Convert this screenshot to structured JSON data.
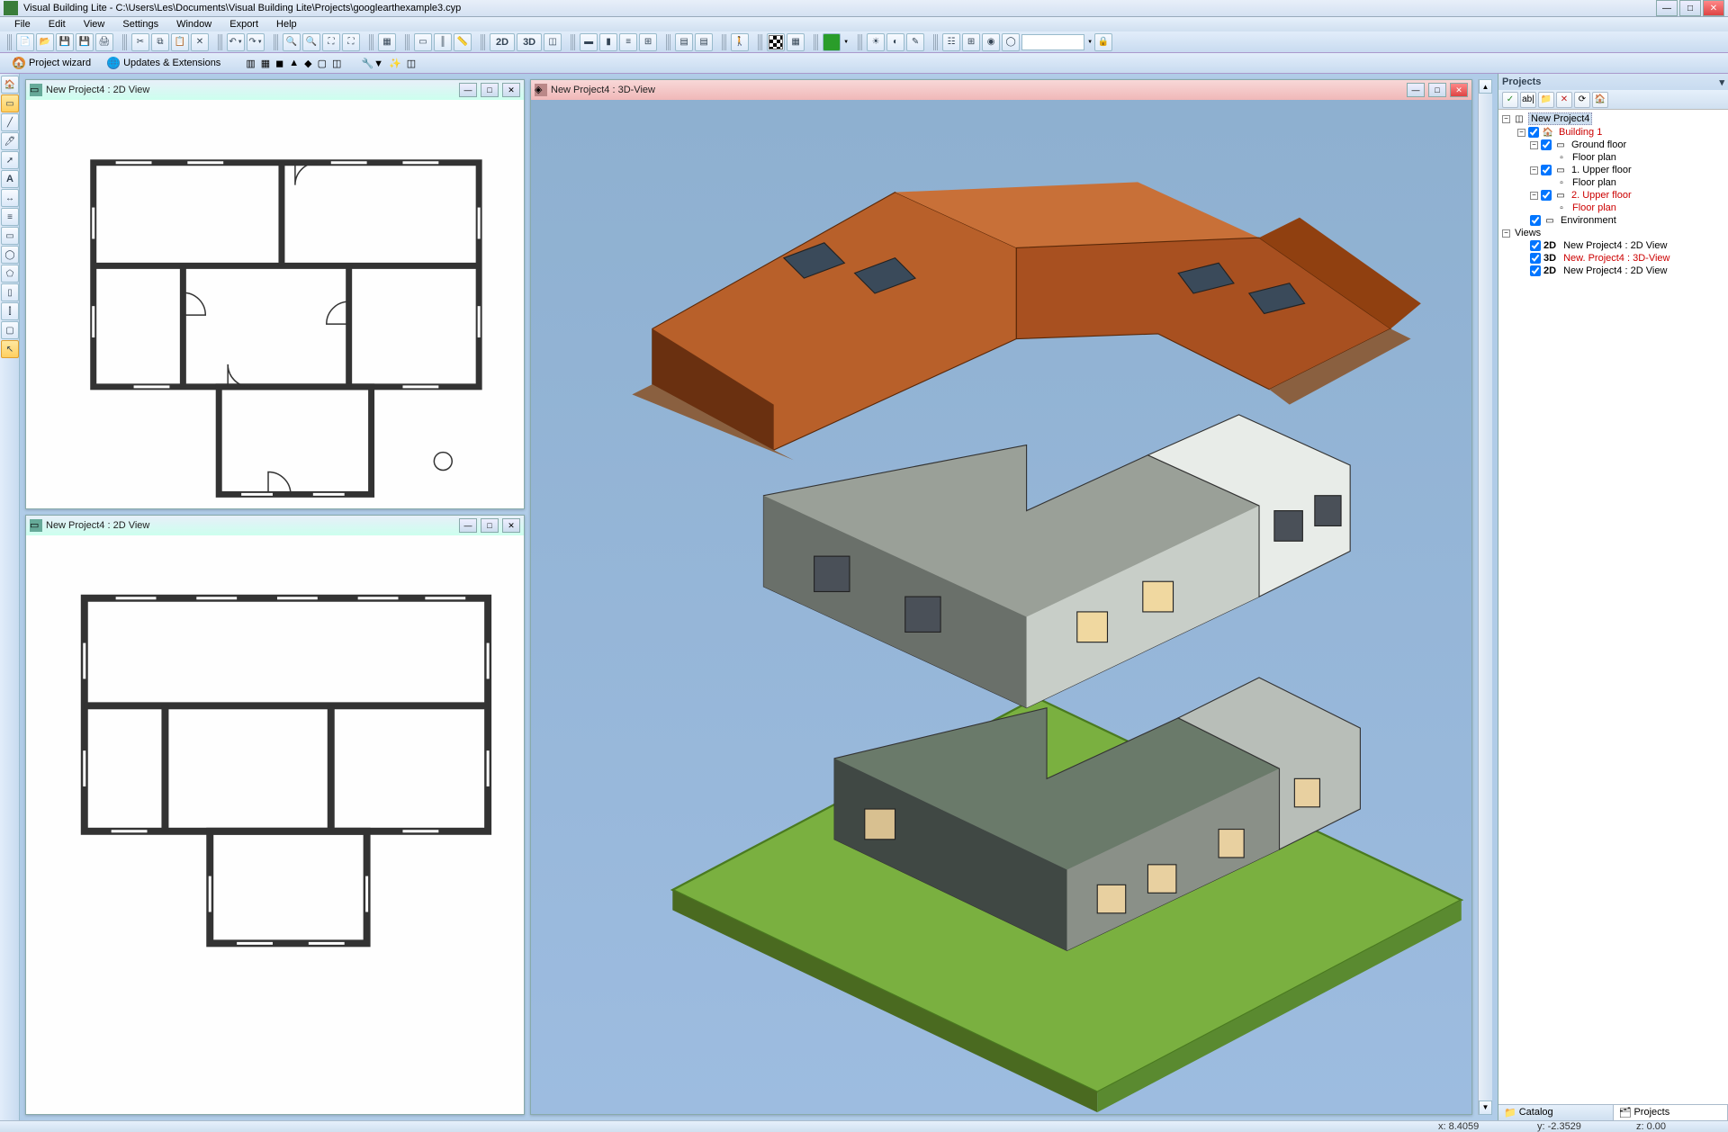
{
  "app": {
    "title": "Visual Building Lite - C:\\Users\\Les\\Documents\\Visual Building Lite\\Projects\\googlearthexample3.cyp"
  },
  "menu": [
    "File",
    "Edit",
    "View",
    "Settings",
    "Window",
    "Export",
    "Help"
  ],
  "toolbar2": {
    "wizard": "Project wizard",
    "updates": "Updates & Extensions"
  },
  "windows": {
    "view2d_a": "New Project4 : 2D View",
    "view2d_b": "New Project4 : 2D View",
    "view3d": "New Project4 : 3D-View"
  },
  "projects_panel": {
    "title": "Projects",
    "tree": {
      "root": "New Project4",
      "building": "Building 1",
      "ground_floor": "Ground floor",
      "floor_plan_1": "Floor plan",
      "upper_floor_1": "1. Upper floor",
      "floor_plan_2": "Floor plan",
      "upper_floor_2": "2. Upper floor",
      "floor_plan_3": "Floor plan",
      "environment": "Environment",
      "views": "Views",
      "view1": "New Project4 : 2D View",
      "view2": "New. Project4 : 3D-View",
      "view3": "New Project4 : 2D View",
      "v1prefix": "2D",
      "v2prefix": "3D",
      "v3prefix": "2D"
    },
    "tabs": {
      "catalog": "Catalog",
      "projects": "Projects"
    }
  },
  "status": {
    "x": "x: 8.4059",
    "y": "y: -2.3529",
    "z": "z: 0.00"
  }
}
